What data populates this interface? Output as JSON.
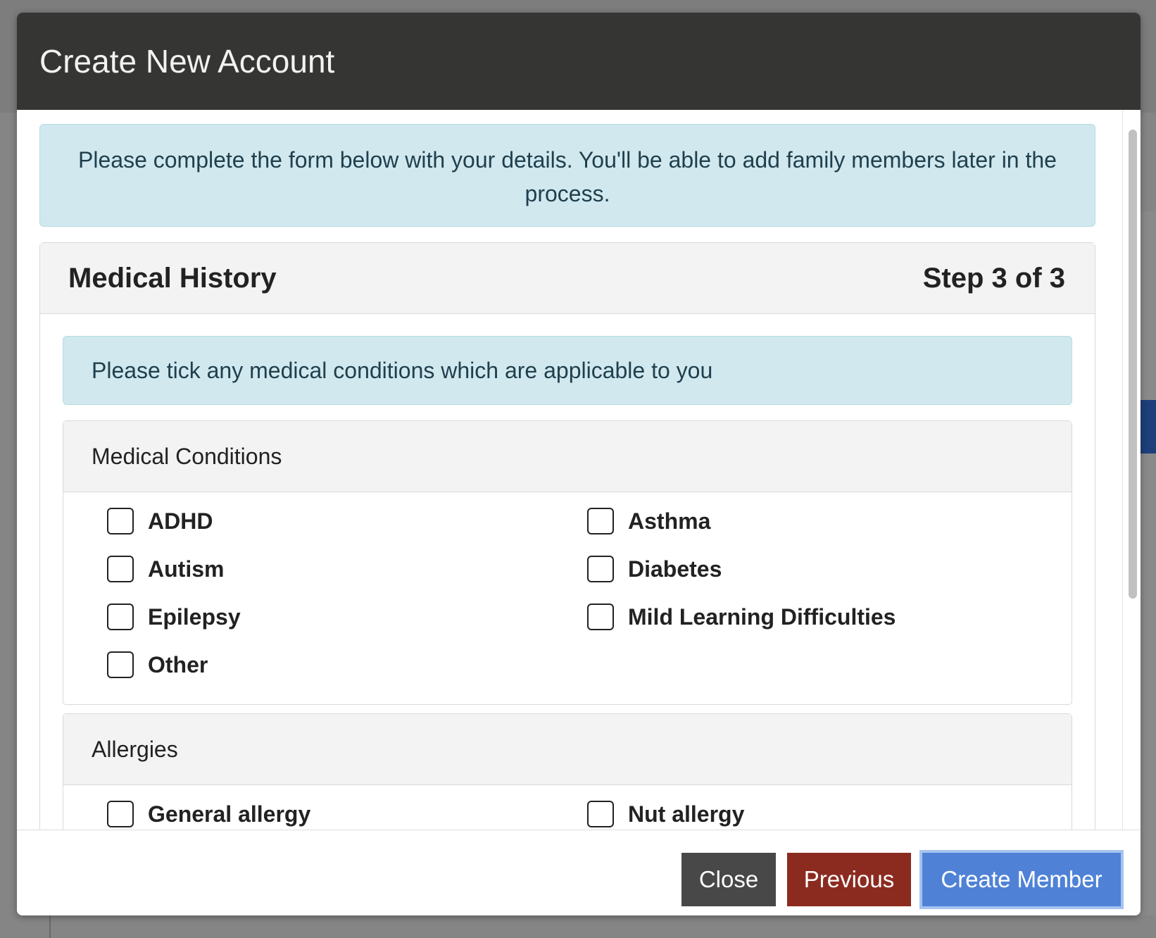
{
  "modal": {
    "title": "Create New Account",
    "intro": "Please complete the form below with your details. You'll be able to add family members later in the process."
  },
  "card": {
    "title": "Medical History",
    "step": "Step 3 of 3",
    "instruction": "Please tick any medical conditions which are applicable to you"
  },
  "medical_conditions": {
    "heading": "Medical Conditions",
    "items": [
      {
        "label": "ADHD",
        "checked": false
      },
      {
        "label": "Asthma",
        "checked": false
      },
      {
        "label": "Autism",
        "checked": false
      },
      {
        "label": "Diabetes",
        "checked": false
      },
      {
        "label": "Epilepsy",
        "checked": false
      },
      {
        "label": "Mild Learning Difficulties",
        "checked": false
      },
      {
        "label": "Other",
        "checked": false
      }
    ]
  },
  "allergies": {
    "heading": "Allergies",
    "items": [
      {
        "label": "General allergy",
        "checked": false
      },
      {
        "label": "Nut allergy",
        "checked": false
      }
    ]
  },
  "footer": {
    "close_label": "Close",
    "previous_label": "Previous",
    "create_label": "Create Member"
  },
  "colors": {
    "header_bg": "#353533",
    "alert_bg": "#d1e8ee",
    "close_btn": "#484848",
    "previous_btn": "#8b2b20",
    "create_btn": "#4f82d6"
  }
}
